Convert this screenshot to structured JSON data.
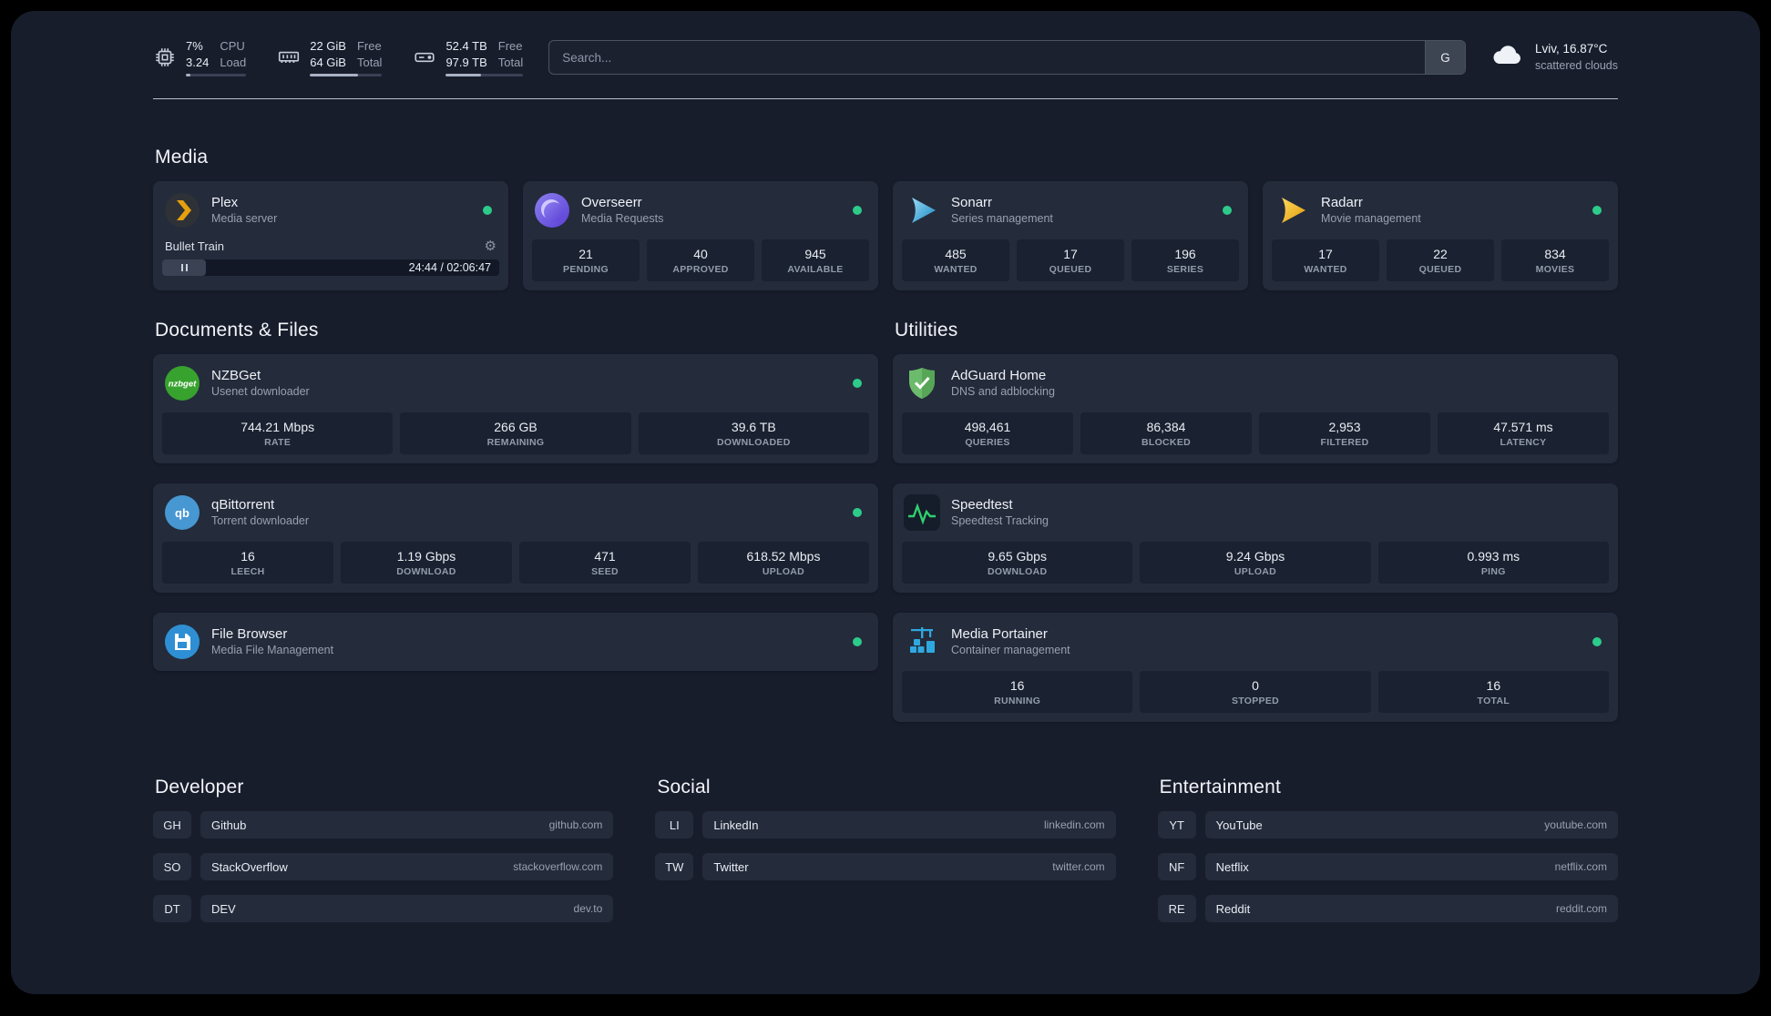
{
  "colors": {
    "status_green": "#2dcb8a",
    "plex_yellow": "#e5a00d",
    "background": "#181d2c",
    "card": "#242b3b"
  },
  "topbar": {
    "cpu": {
      "value_top": "7%",
      "value_bottom": "3.24",
      "label_top": "CPU",
      "label_bottom": "Load",
      "bar_style": "width:7%"
    },
    "memory": {
      "value_top": "22 GiB",
      "value_bottom": "64 GiB",
      "label_top": "Free",
      "label_bottom": "Total",
      "bar_style": "width:66%"
    },
    "disk": {
      "value_top": "52.4 TB",
      "value_bottom": "97.9 TB",
      "label_top": "Free",
      "label_bottom": "Total",
      "bar_style": "width:46%"
    },
    "search": {
      "placeholder": "Search...",
      "button_label": "G"
    },
    "weather": {
      "location": "Lviv, 16.87°C",
      "condition": "scattered clouds"
    }
  },
  "sections": {
    "media": "Media",
    "files": "Documents & Files",
    "utilities": "Utilities"
  },
  "services": {
    "plex": {
      "name": "Plex",
      "subtitle": "Media server",
      "now_playing": {
        "title": "Bullet Train",
        "time": "24:44 / 02:06:47"
      }
    },
    "overseerr": {
      "name": "Overseerr",
      "subtitle": "Media Requests",
      "stats": [
        {
          "value": "21",
          "label": "PENDING"
        },
        {
          "value": "40",
          "label": "APPROVED"
        },
        {
          "value": "945",
          "label": "AVAILABLE"
        }
      ]
    },
    "sonarr": {
      "name": "Sonarr",
      "subtitle": "Series management",
      "stats": [
        {
          "value": "485",
          "label": "WANTED"
        },
        {
          "value": "17",
          "label": "QUEUED"
        },
        {
          "value": "196",
          "label": "SERIES"
        }
      ]
    },
    "radarr": {
      "name": "Radarr",
      "subtitle": "Movie management",
      "stats": [
        {
          "value": "17",
          "label": "WANTED"
        },
        {
          "value": "22",
          "label": "QUEUED"
        },
        {
          "value": "834",
          "label": "MOVIES"
        }
      ]
    },
    "nzbget": {
      "name": "NZBGet",
      "subtitle": "Usenet downloader",
      "stats": [
        {
          "value": "744.21 Mbps",
          "label": "RATE"
        },
        {
          "value": "266 GB",
          "label": "REMAINING"
        },
        {
          "value": "39.6 TB",
          "label": "DOWNLOADED"
        }
      ]
    },
    "qbittorrent": {
      "name": "qBittorrent",
      "subtitle": "Torrent downloader",
      "stats": [
        {
          "value": "16",
          "label": "LEECH"
        },
        {
          "value": "1.19 Gbps",
          "label": "DOWNLOAD"
        },
        {
          "value": "471",
          "label": "SEED"
        },
        {
          "value": "618.52 Mbps",
          "label": "UPLOAD"
        }
      ]
    },
    "filebrowser": {
      "name": "File Browser",
      "subtitle": "Media File Management"
    },
    "adguard": {
      "name": "AdGuard Home",
      "subtitle": "DNS and adblocking",
      "stats": [
        {
          "value": "498,461",
          "label": "QUERIES"
        },
        {
          "value": "86,384",
          "label": "BLOCKED"
        },
        {
          "value": "2,953",
          "label": "FILTERED"
        },
        {
          "value": "47.571 ms",
          "label": "LATENCY"
        }
      ]
    },
    "speedtest": {
      "name": "Speedtest",
      "subtitle": "Speedtest Tracking",
      "stats": [
        {
          "value": "9.65 Gbps",
          "label": "DOWNLOAD"
        },
        {
          "value": "9.24 Gbps",
          "label": "UPLOAD"
        },
        {
          "value": "0.993 ms",
          "label": "PING"
        }
      ]
    },
    "portainer": {
      "name": "Media Portainer",
      "subtitle": "Container management",
      "stats": [
        {
          "value": "16",
          "label": "RUNNING"
        },
        {
          "value": "0",
          "label": "STOPPED"
        },
        {
          "value": "16",
          "label": "TOTAL"
        }
      ]
    }
  },
  "bookmarks": [
    {
      "title": "Developer",
      "items": [
        {
          "abbr": "GH",
          "label": "Github",
          "url": "github.com"
        },
        {
          "abbr": "SO",
          "label": "StackOverflow",
          "url": "stackoverflow.com"
        },
        {
          "abbr": "DT",
          "label": "DEV",
          "url": "dev.to"
        }
      ]
    },
    {
      "title": "Social",
      "items": [
        {
          "abbr": "LI",
          "label": "LinkedIn",
          "url": "linkedin.com"
        },
        {
          "abbr": "TW",
          "label": "Twitter",
          "url": "twitter.com"
        }
      ]
    },
    {
      "title": "Entertainment",
      "items": [
        {
          "abbr": "YT",
          "label": "YouTube",
          "url": "youtube.com"
        },
        {
          "abbr": "NF",
          "label": "Netflix",
          "url": "netflix.com"
        },
        {
          "abbr": "RE",
          "label": "Reddit",
          "url": "reddit.com"
        }
      ]
    }
  ]
}
